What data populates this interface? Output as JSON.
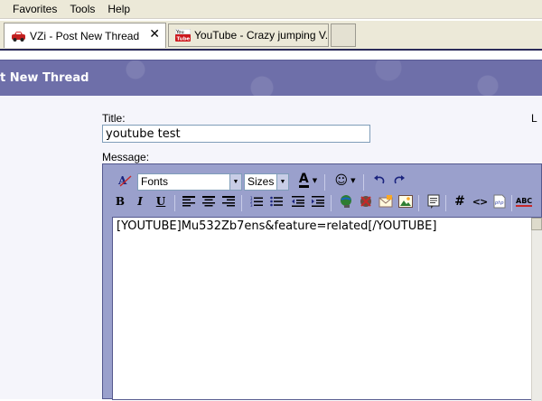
{
  "menubar": {
    "items": [
      {
        "label": "Favorites"
      },
      {
        "label": "Tools"
      },
      {
        "label": "Help"
      }
    ]
  },
  "tabs": [
    {
      "label": "VZi - Post New Thread",
      "close": "✕"
    },
    {
      "label": "YouTube - Crazy jumping V..."
    }
  ],
  "page": {
    "header_title": "t New Thread",
    "title_label": "Title:",
    "title_value": "youtube test",
    "message_label": "Message:",
    "right_label": "L"
  },
  "editor": {
    "font_select": "Fonts",
    "size_select": "Sizes",
    "font_color_glyph": "A",
    "buttons": {
      "bold": "B",
      "italic": "I",
      "underline": "U",
      "hash": "#",
      "code": "<>",
      "php": "php",
      "spell": "ABC"
    },
    "message_content": "[YOUTUBE]Mu532Zb7ens&feature=related[/YOUTUBE]"
  },
  "colors": {
    "chrome_bg": "#ece9d8",
    "header_band": "#6e6fa9",
    "editor_bg": "#9aa0cc"
  }
}
